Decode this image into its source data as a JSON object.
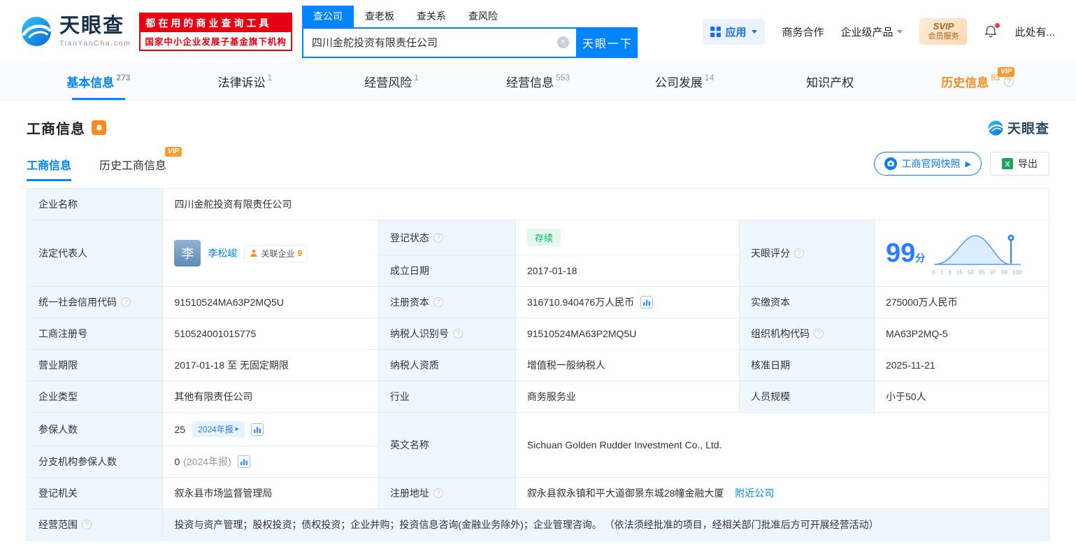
{
  "brand": {
    "name": "天眼查",
    "domain": "TianYanCha.com"
  },
  "header": {
    "slogan_line1": "都在用的商业查询工具",
    "slogan_line2": "国家中小企业发展子基金旗下机构",
    "search_tabs": [
      {
        "label": "查公司"
      },
      {
        "label": "查老板"
      },
      {
        "label": "查关系"
      },
      {
        "label": "查风险"
      }
    ],
    "search_value": "四川金舵投资有限责任公司",
    "search_button": "天眼一下",
    "apps_label": "应用",
    "menu_biz": "商务合作",
    "menu_products": "企业级产品",
    "vip_line1": "SVIP",
    "vip_line2": "会员服务",
    "username": "此处有..."
  },
  "nav_tabs": [
    {
      "label": "基本信息",
      "count": "273"
    },
    {
      "label": "法律诉讼",
      "count": "1"
    },
    {
      "label": "经营风险",
      "count": "1"
    },
    {
      "label": "经营信息",
      "count": "553"
    },
    {
      "label": "公司发展",
      "count": "14"
    },
    {
      "label": "知识产权",
      "count": ""
    },
    {
      "label": "历史信息",
      "count": "53"
    }
  ],
  "section": {
    "title": "工商信息",
    "tab_current": "工商信息",
    "tab_history": "历史工商信息",
    "vip_tag": "VIP",
    "snapshot_button": "工商官网快照",
    "export_button": "导出"
  },
  "fields": {
    "company_name": {
      "label": "企业名称",
      "value": "四川金舵投资有限责任公司"
    },
    "legal_rep": {
      "label": "法定代表人",
      "avatar": "李",
      "name": "李松峻",
      "related_label": "关联企业",
      "related_count": "9"
    },
    "reg_status": {
      "label": "登记状态",
      "value": "存续"
    },
    "establish_date": {
      "label": "成立日期",
      "value": "2017-01-18"
    },
    "score": {
      "label": "天眼评分",
      "value": "99",
      "unit": "分"
    },
    "credit_code": {
      "label": "统一社会信用代码",
      "value": "91510524MA63P2MQ5U"
    },
    "reg_capital": {
      "label": "注册资本",
      "value": "316710.940476万人民币"
    },
    "paid_capital": {
      "label": "实缴资本",
      "value": "275000万人民币"
    },
    "reg_number": {
      "label": "工商注册号",
      "value": "510524001015775"
    },
    "taxpayer_id": {
      "label": "纳税人识别号",
      "value": "91510524MA63P2MQ5U"
    },
    "org_code": {
      "label": "组织机构代码",
      "value": "MA63P2MQ-5"
    },
    "business_term": {
      "label": "营业期限",
      "value": "2017-01-18 至 无固定期限"
    },
    "taxpayer_quality": {
      "label": "纳税人资质",
      "value": "增值税一般纳税人"
    },
    "approval_date": {
      "label": "核准日期",
      "value": "2025-11-21"
    },
    "company_type": {
      "label": "企业类型",
      "value": "其他有限责任公司"
    },
    "industry": {
      "label": "行业",
      "value": "商务服务业"
    },
    "staff_size": {
      "label": "人员规模",
      "value": "小于50人"
    },
    "insured_num": {
      "label": "参保人数",
      "value": "25",
      "badge": "2024年报"
    },
    "english_name": {
      "label": "英文名称",
      "value": "Sichuan Golden Rudder Investment Co., Ltd."
    },
    "branch_insured": {
      "label": "分支机构参保人数",
      "value": "0",
      "note": "(2024年报)"
    },
    "reg_authority": {
      "label": "登记机关",
      "value": "叙永县市场监督管理局"
    },
    "reg_address": {
      "label": "注册地址",
      "value": "叙永县叙永镇和平大道御景东城28幢金融大厦",
      "link": "附近公司"
    },
    "business_scope": {
      "label": "经营范围",
      "value": "投资与资产管理；股权投资；债权投资；企业并购；投资信息咨询(金融业务除外)；企业管理咨询。 （依法须经批准的项目，经相关部门批准后方可开展经营活动）"
    }
  },
  "score_chart": {
    "axis": [
      "0",
      "1",
      "3",
      "15",
      "50",
      "85",
      "97",
      "99",
      "100"
    ]
  },
  "colors": {
    "primary": "#0084ff",
    "orange": "#ff8a1e",
    "status_green": "#00b365",
    "banner_red": "#e60012"
  }
}
